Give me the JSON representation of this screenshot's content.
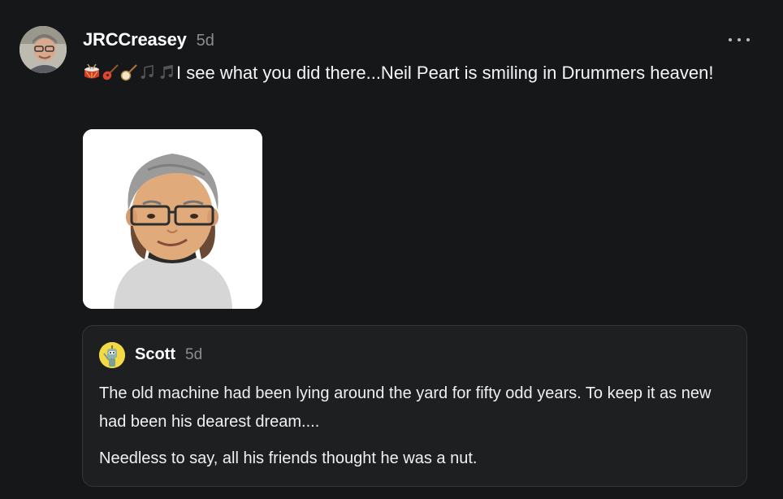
{
  "post": {
    "author": "JRCCreasey",
    "timestamp": "5d",
    "avatar_icon": "user-photo-avatar",
    "emojis": [
      "drum",
      "guitar",
      "banjo",
      "notes",
      "music-note"
    ],
    "text": "I see what you did there...Neil Peart is smiling in Drummers heaven!",
    "image_icon": "memoji-avatar-image",
    "more_icon": "more-horizontal-icon"
  },
  "quote": {
    "author": "Scott",
    "timestamp": "5d",
    "avatar_icon": "robot-avatar",
    "paragraph1": "The old machine had been lying around the yard for fifty odd years. To keep it as new had been his dearest dream....",
    "paragraph2": "Needless to say, all his friends thought he was a nut."
  },
  "colors": {
    "background": "#161719",
    "card_background": "#1e1f21",
    "card_border": "#34363a",
    "muted_text": "#8a8d91"
  }
}
